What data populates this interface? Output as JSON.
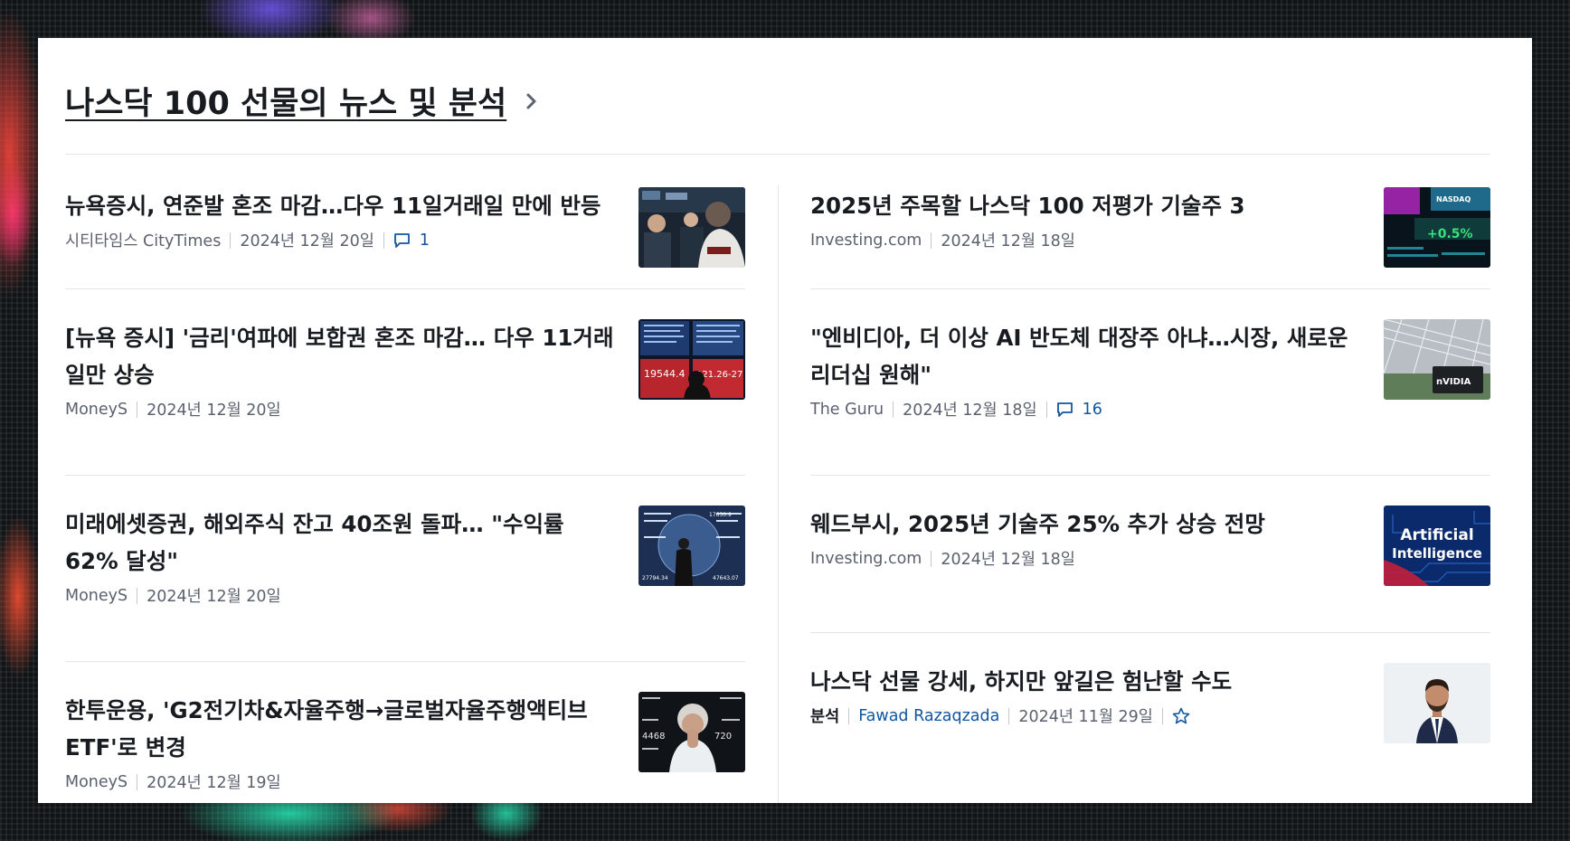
{
  "section": {
    "title": "나스닥 100 선물의 뉴스 및 분석"
  },
  "articles_left": [
    {
      "headline": "뉴욕증시, 연준발 혼조 마감…다우 11일거래일 만에 반등",
      "source": "시티타임스 CityTimes",
      "date": "2024년 12월 20일",
      "comments": "1",
      "thumb_icon": "trader-photo"
    },
    {
      "headline": "[뉴욕 증시] '금리'여파에 보합권 혼조 마감… 다우 11거래일만 상승",
      "source": "MoneyS",
      "date": "2024년 12월 20일",
      "thumb_icon": "stock-board-photo",
      "thumb_text": [
        "19544.4",
        "121.26-27"
      ]
    },
    {
      "headline": "미래에셋증권, 해외주식 잔고 40조원 돌파… \"수익률 62% 달성\"",
      "source": "MoneyS",
      "date": "2024년 12월 20일",
      "thumb_icon": "market-screen-photo",
      "thumb_text": [
        "17630.9",
        "27794.34",
        "47643.07"
      ]
    },
    {
      "headline": "한투운용, 'G2전기차&자율주행→글로벌자율주행액티브 ETF'로 변경",
      "source": "MoneyS",
      "date": "2024년 12월 19일",
      "thumb_icon": "worried-trader-photo",
      "thumb_text": [
        "4468",
        "720"
      ]
    }
  ],
  "articles_right": [
    {
      "headline": "2025년 주목할 나스닥 100 저평가 기술주 3",
      "source": "Investing.com",
      "date": "2024년 12월 18일",
      "thumb_icon": "nasdaq-sign-photo",
      "thumb_text": [
        "NASDAQ",
        "+0.5%"
      ]
    },
    {
      "headline": "\"엔비디아, 더 이상 AI 반도체 대장주 아냐…시장, 새로운 리더십 원해\"",
      "source": "The Guru",
      "date": "2024년 12월 18일",
      "comments": "16",
      "thumb_icon": "nvidia-building-photo",
      "thumb_text": [
        "nVIDIA"
      ]
    },
    {
      "headline": "웨드부시, 2025년 기술주 25% 추가 상승 전망",
      "source": "Investing.com",
      "date": "2024년 12월 18일",
      "thumb_icon": "ai-circuit-photo",
      "thumb_text": [
        "Artificial",
        "Intelligence"
      ]
    },
    {
      "headline": "나스닥 선물 강세, 하지만 앞길은 험난할 수도",
      "kind": "분석",
      "author": "Fawad Razaqzada",
      "date": "2024년 11월 29일",
      "thumb_icon": "author-portrait-photo",
      "bookmark_icon": "star-outline-icon"
    }
  ],
  "icons": {
    "header_arrow": "chevron-right-icon",
    "comments": "comment-bubble-icon"
  },
  "colors": {
    "link_blue": "#1256a0",
    "meta_gray": "#5b616e",
    "title": "#181c21",
    "divider": "#e4e6ea"
  }
}
